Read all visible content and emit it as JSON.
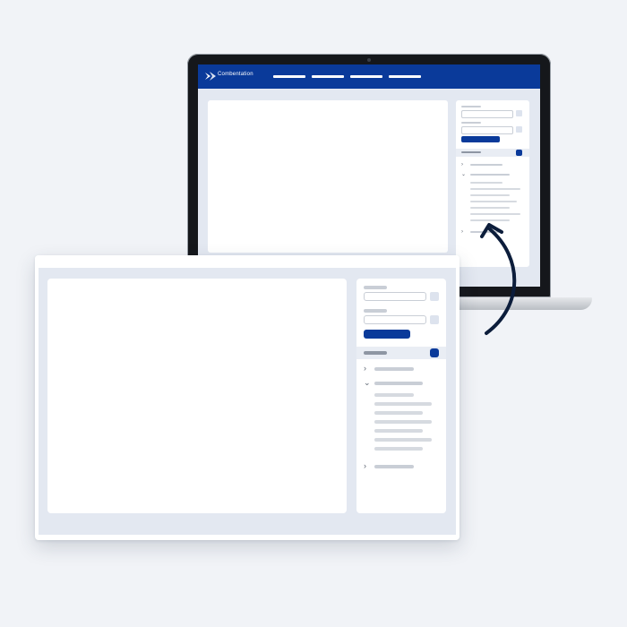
{
  "app": {
    "logo_text": "Combentation",
    "brand_color": "#0a3a9a"
  },
  "icons": {
    "chevron_right": "›",
    "chevron_down": "⌄"
  }
}
